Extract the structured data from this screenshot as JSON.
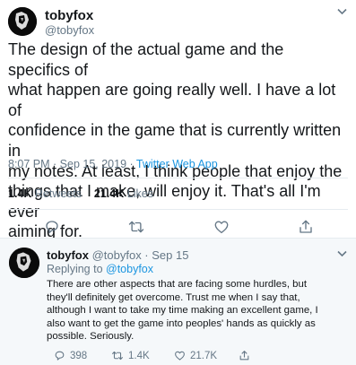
{
  "tweet": {
    "display_name": "tobyfox",
    "handle": "@tobyfox",
    "text_lines": [
      "The design of the actual game and the specifics of",
      "what happen are going really well. I have a lot of",
      "confidence in the game that is currently written in",
      "my notes. At least, I think people that enjoy the",
      "things that I make, will enjoy it. That's all I'm ever",
      "aiming for."
    ],
    "timestamp": "8:07 PM · Sep 15, 2019 · ",
    "source": "Twitter Web App",
    "retweets_count": "1.4K",
    "retweets_label": "Retweets",
    "likes_count": "21.4K",
    "likes_label": "Likes"
  },
  "reply": {
    "display_name": "tobyfox",
    "handle_date": "@tobyfox · Sep 15",
    "replying_prefix": "Replying to ",
    "replying_to": "@tobyfox",
    "text_lines": [
      "There are other aspects that are facing some hurdles, but",
      "they'll definitely get overcome. Trust me when I say that,",
      "although I want to take my time making an excellent game, I",
      "also want to get the game into peoples' hands as quickly as",
      "possible. Seriously."
    ],
    "reply_count": "398",
    "retweet_count": "1.4K",
    "like_count": "21.7K"
  },
  "colors": {
    "text": "#14171a",
    "muted": "#657786",
    "link": "#1b95e0",
    "divider": "#e6ecf0",
    "thread_bg": "#f5f8fa"
  },
  "icons": [
    "chevron-down-icon",
    "reply-icon",
    "retweet-icon",
    "like-icon",
    "share-icon"
  ]
}
